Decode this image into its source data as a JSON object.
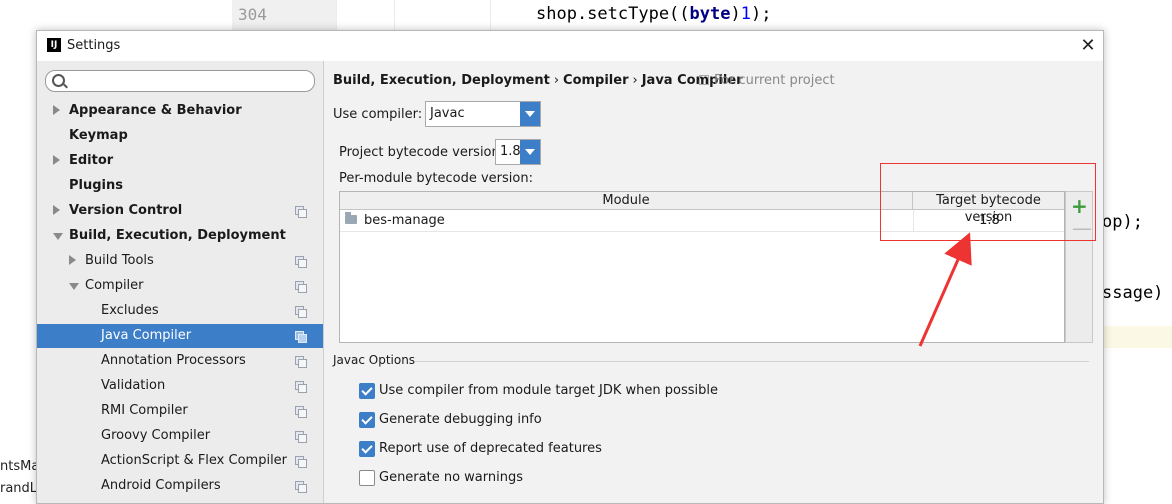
{
  "editor": {
    "line_number": "304",
    "code_line": {
      "before": "shop.setcType((",
      "keyword": "byte",
      "middle": ")",
      "number": "1",
      "after": ");"
    },
    "frag_1": "op);",
    "frag_2": "ssage)",
    "side_1": "ntsMa",
    "side_2": "randLi"
  },
  "dialog": {
    "app_icon": "IJ",
    "title": "Settings",
    "close_label": "✕"
  },
  "sidebar": {
    "search_placeholder": "",
    "items": [
      {
        "label": "Appearance & Behavior",
        "bold": true,
        "arrow": "right",
        "project": false
      },
      {
        "label": "Keymap",
        "bold": true,
        "arrow": "none",
        "project": false
      },
      {
        "label": "Editor",
        "bold": true,
        "arrow": "right",
        "project": false
      },
      {
        "label": "Plugins",
        "bold": true,
        "arrow": "none",
        "project": false
      },
      {
        "label": "Version Control",
        "bold": true,
        "arrow": "right",
        "project": true
      },
      {
        "label": "Build, Execution, Deployment",
        "bold": true,
        "arrow": "down",
        "project": false
      },
      {
        "label": "Build Tools",
        "bold": false,
        "arrow": "right",
        "project": true
      },
      {
        "label": "Compiler",
        "bold": false,
        "arrow": "down",
        "project": true
      },
      {
        "label": "Excludes",
        "bold": false,
        "arrow": "none",
        "project": true
      },
      {
        "label": "Java Compiler",
        "bold": false,
        "arrow": "none",
        "project": true,
        "selected": true
      },
      {
        "label": "Annotation Processors",
        "bold": false,
        "arrow": "none",
        "project": true
      },
      {
        "label": "Validation",
        "bold": false,
        "arrow": "none",
        "project": true
      },
      {
        "label": "RMI Compiler",
        "bold": false,
        "arrow": "none",
        "project": true
      },
      {
        "label": "Groovy Compiler",
        "bold": false,
        "arrow": "none",
        "project": true
      },
      {
        "label": "ActionScript & Flex Compiler",
        "bold": false,
        "arrow": "none",
        "project": true
      },
      {
        "label": "Android Compilers",
        "bold": false,
        "arrow": "none",
        "project": true
      }
    ]
  },
  "breadcrumb": {
    "items": [
      "Build, Execution, Deployment",
      "Compiler",
      "Java Compiler"
    ],
    "separator": "›",
    "scope": "For current project"
  },
  "form": {
    "use_compiler_label": "Use compiler:",
    "use_compiler_value": "Javac",
    "project_bytecode_label": "Project bytecode version:",
    "project_bytecode_value": "1.8",
    "per_module_label": "Per-module bytecode version:"
  },
  "module_table": {
    "columns": [
      "Module",
      "Target bytecode version"
    ],
    "rows": [
      {
        "module": "bes-manage",
        "target": "1.8"
      }
    ],
    "add_label": "+",
    "remove_label": "—"
  },
  "javac_options": {
    "title": "Javac Options",
    "checkboxes": [
      {
        "label": "Use compiler from module target JDK when possible",
        "checked": true
      },
      {
        "label": "Generate debugging info",
        "checked": true
      },
      {
        "label": "Report use of deprecated features",
        "checked": true
      },
      {
        "label": "Generate no warnings",
        "checked": false
      }
    ]
  },
  "colors": {
    "accent": "#3d7ec9",
    "annotation": "#ee3333",
    "add_green": "#3b9b3b"
  }
}
